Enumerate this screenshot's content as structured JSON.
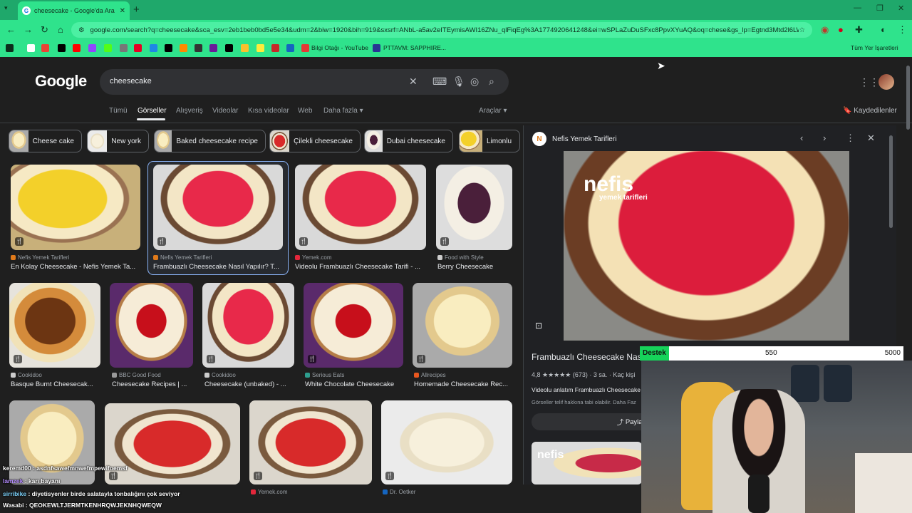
{
  "browser": {
    "tab_title": "cheesecake - Google'da Ara",
    "tab_close": "✕",
    "new_tab": "+",
    "url": "google.com/search?q=cheesecake&sca_esv=2eb1beb0bd5e5e34&udm=2&biw=1920&bih=919&sxsrf=ANbL-a5av2eITEymisAWI16ZNu_qlFiqEg%3A1774920641248&ei=wSPLaZuDuSFxc8PpvXYuAQ&oq=chese&gs_lp=Egtnd3Mtd2l6LWl...",
    "bookmarks": [
      "Bilgi Otağı - YouTube",
      "PTTAVM: SAPPHIRE..."
    ],
    "all_bookmarks": "Tüm Yer İşaretleri"
  },
  "google": {
    "logo": "Google",
    "query": "cheesecake",
    "nav": [
      "Tümü",
      "Görseller",
      "Alışveriş",
      "Videolar",
      "Kısa videolar",
      "Web",
      "Daha fazla"
    ],
    "tools": "Araçlar",
    "saved": "Kaydedilenler",
    "chips": [
      "Cheese cake",
      "New york",
      "Baked cheesecake recipe",
      "Çilekli cheesecake",
      "Dubai cheesecake",
      "Limonlu"
    ]
  },
  "results": [
    {
      "source": "Nefis Yemek Tarifleri",
      "caption": "En Kolay Cheesecake - Nefis Yemek Ta..."
    },
    {
      "source": "Nefis Yemek Tarifleri",
      "caption": "Frambuazlı Cheesecake Nasıl Yapılır? T..."
    },
    {
      "source": "Yemek.com",
      "caption": "Videolu Frambuazlı Cheesecake Tarifi - ..."
    },
    {
      "source": "Food with Style",
      "caption": "Berry Cheesecake"
    },
    {
      "source": "Cookidoo",
      "caption": "Basque Burnt Cheesecak..."
    },
    {
      "source": "BBC Good Food",
      "caption": "Cheesecake Recipes | ..."
    },
    {
      "source": "Cookidoo",
      "caption": "Cheesecake (unbaked) - ..."
    },
    {
      "source": "Serious Eats",
      "caption": "White Chocolate Cheesecake"
    },
    {
      "source": "Allrecipes",
      "caption": "Homemade Cheesecake Rec..."
    },
    {
      "source": "Yemek.com",
      "caption": ""
    },
    {
      "source": "Dr. Oetker",
      "caption": ""
    }
  ],
  "panel": {
    "source": "Nefis Yemek Tarifleri",
    "logo_text": "nefis",
    "logo_sub": "yemek tarifleri",
    "title": "Frambuazlı Cheesecake Nas",
    "rating": "4,8 ★★★★★ (673)  ·  3 sa.  ·  Kaç kişi",
    "desc": "Videolu anlatım Frambuazlı Cheesecake",
    "note": "Görseller telif hakkına tabi olabilir. Daha Faz",
    "share": "Paylaş",
    "thumb_logo": "nefis"
  },
  "goal": {
    "label": "Destek",
    "current": "550",
    "max": "5000",
    "progress": 0.11
  },
  "chat": [
    {
      "user": "keremd00",
      "msg": "asdnfsawefmnwefmpewifoemsf"
    },
    {
      "user": "lamzek",
      "msg": "karı bayanı"
    },
    {
      "user": "sirribike",
      "msg": "diyetisyenler birde salatayla tonbalığını çok seviyor"
    },
    {
      "user": "Wasabi",
      "msg": "QEOKEWLTJERMTKENHRQWJEKNHQWEQW"
    }
  ],
  "colors": {
    "accent": "#2fe38c",
    "tab_bar": "#1fa86b",
    "link": "#8ab4f8",
    "goal_fill": "#16d35a"
  }
}
